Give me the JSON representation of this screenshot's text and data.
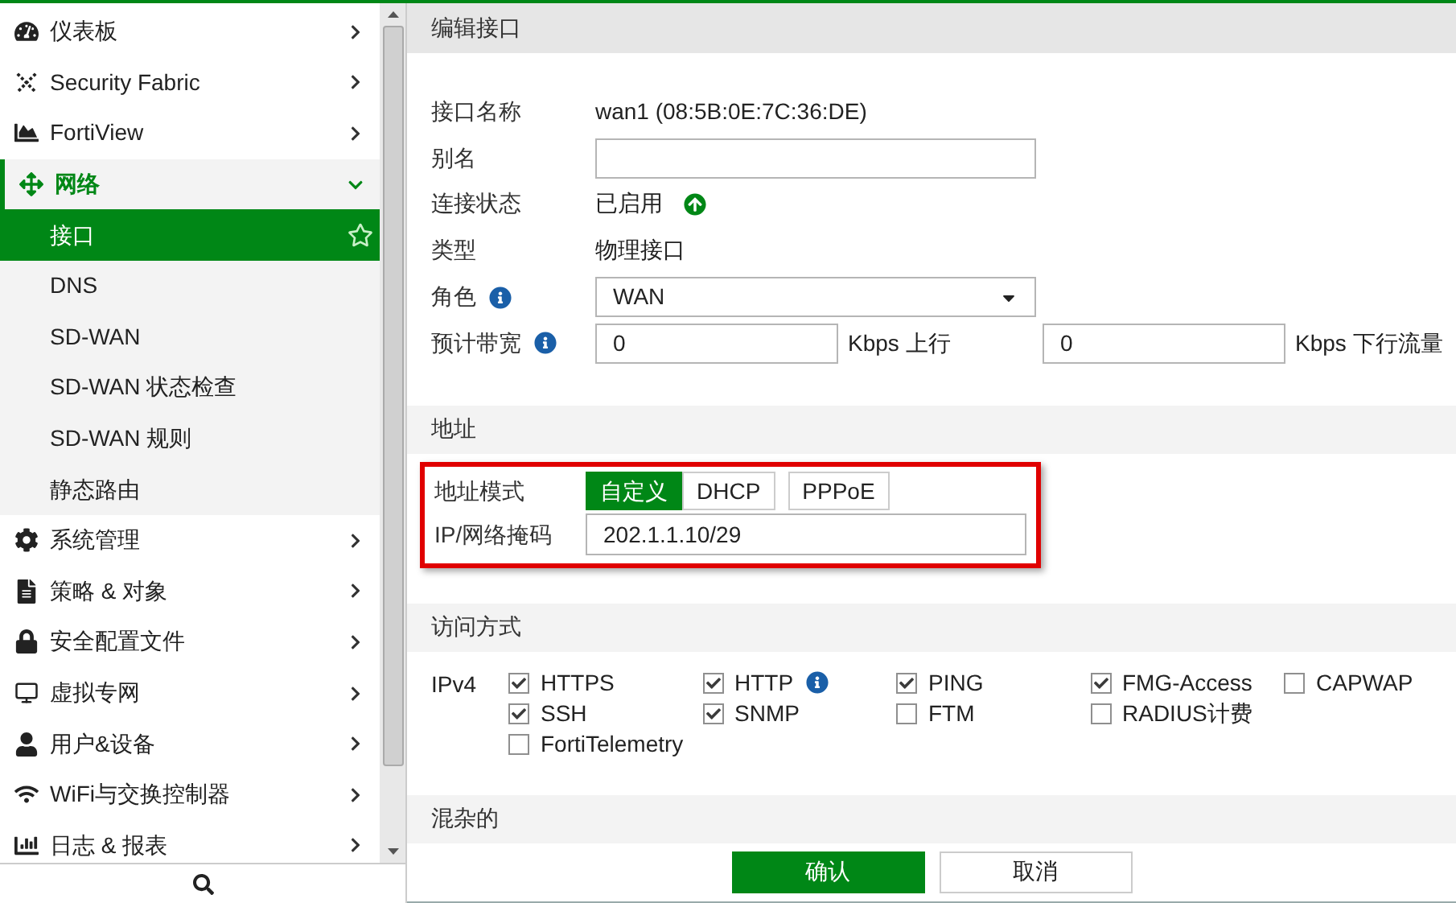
{
  "sidebar": {
    "items": [
      {
        "label": "仪表板",
        "expanded": false
      },
      {
        "label": "Security Fabric",
        "expanded": false
      },
      {
        "label": "FortiView",
        "expanded": false
      },
      {
        "label": "网络",
        "expanded": true,
        "children": [
          {
            "label": "接口",
            "selected": true,
            "favorite": true
          },
          {
            "label": "DNS",
            "selected": false,
            "favorite": false
          },
          {
            "label": "SD-WAN",
            "selected": false,
            "favorite": false
          },
          {
            "label": "SD-WAN 状态检查",
            "selected": false,
            "favorite": false
          },
          {
            "label": "SD-WAN 规则",
            "selected": false,
            "favorite": false
          },
          {
            "label": "静态路由",
            "selected": false,
            "favorite": false
          }
        ]
      },
      {
        "label": "系统管理",
        "expanded": false
      },
      {
        "label": "策略 & 对象",
        "expanded": false
      },
      {
        "label": "安全配置文件",
        "expanded": false
      },
      {
        "label": "虚拟专网",
        "expanded": false
      },
      {
        "label": "用户&设备",
        "expanded": false
      },
      {
        "label": "WiFi与交换控制器",
        "expanded": false
      },
      {
        "label": "日志 & 报表",
        "expanded": false
      }
    ]
  },
  "panel": {
    "title": "编辑接口",
    "fields": [
      {
        "kind": "text",
        "label": "接口名称",
        "value": "wan1 (08:5B:0E:7C:36:DE)"
      },
      {
        "kind": "input",
        "label": "别名"
      },
      {
        "kind": "status",
        "label": "连接状态",
        "value": "已启用",
        "up": true
      },
      {
        "kind": "text",
        "label": "类型",
        "value": "物理接口"
      },
      {
        "kind": "select",
        "label": "角色",
        "info": true,
        "value": "WAN"
      },
      {
        "kind": "bandwidth",
        "label": "预计带宽",
        "info": true,
        "up_value": "0",
        "up_unit": "Kbps 上行",
        "down_value": "0",
        "down_unit": "Kbps 下行流量"
      }
    ],
    "address": {
      "title": "地址",
      "mode_label": "地址模式",
      "modes": [
        {
          "label": "自定义",
          "selected": true
        },
        {
          "label": "DHCP",
          "selected": false
        },
        {
          "label": "PPPoE",
          "selected": false
        }
      ],
      "ip_label": "IP/网络掩码",
      "ip_value": "202.1.1.10/29",
      "highlighted": true
    },
    "access": {
      "title": "访问方式",
      "protocol": "IPv4",
      "rows": [
        [
          {
            "label": "HTTPS",
            "checked": true
          },
          {
            "label": "HTTP",
            "checked": true,
            "info": true
          },
          {
            "label": "PING",
            "checked": true
          },
          {
            "label": "FMG-Access",
            "checked": true
          },
          {
            "label": "CAPWAP",
            "checked": false
          }
        ],
        [
          {
            "label": "SSH",
            "checked": true
          },
          {
            "label": "SNMP",
            "checked": true
          },
          {
            "label": "FTM",
            "checked": false
          },
          {
            "label": "RADIUS计费",
            "checked": false
          }
        ],
        [
          {
            "label": "FortiTelemetry",
            "checked": false
          }
        ]
      ]
    },
    "misc": {
      "title": "混杂的"
    },
    "buttons": [
      {
        "label": "确认",
        "kind": "primary"
      },
      {
        "label": "取消",
        "kind": "secondary"
      }
    ]
  }
}
